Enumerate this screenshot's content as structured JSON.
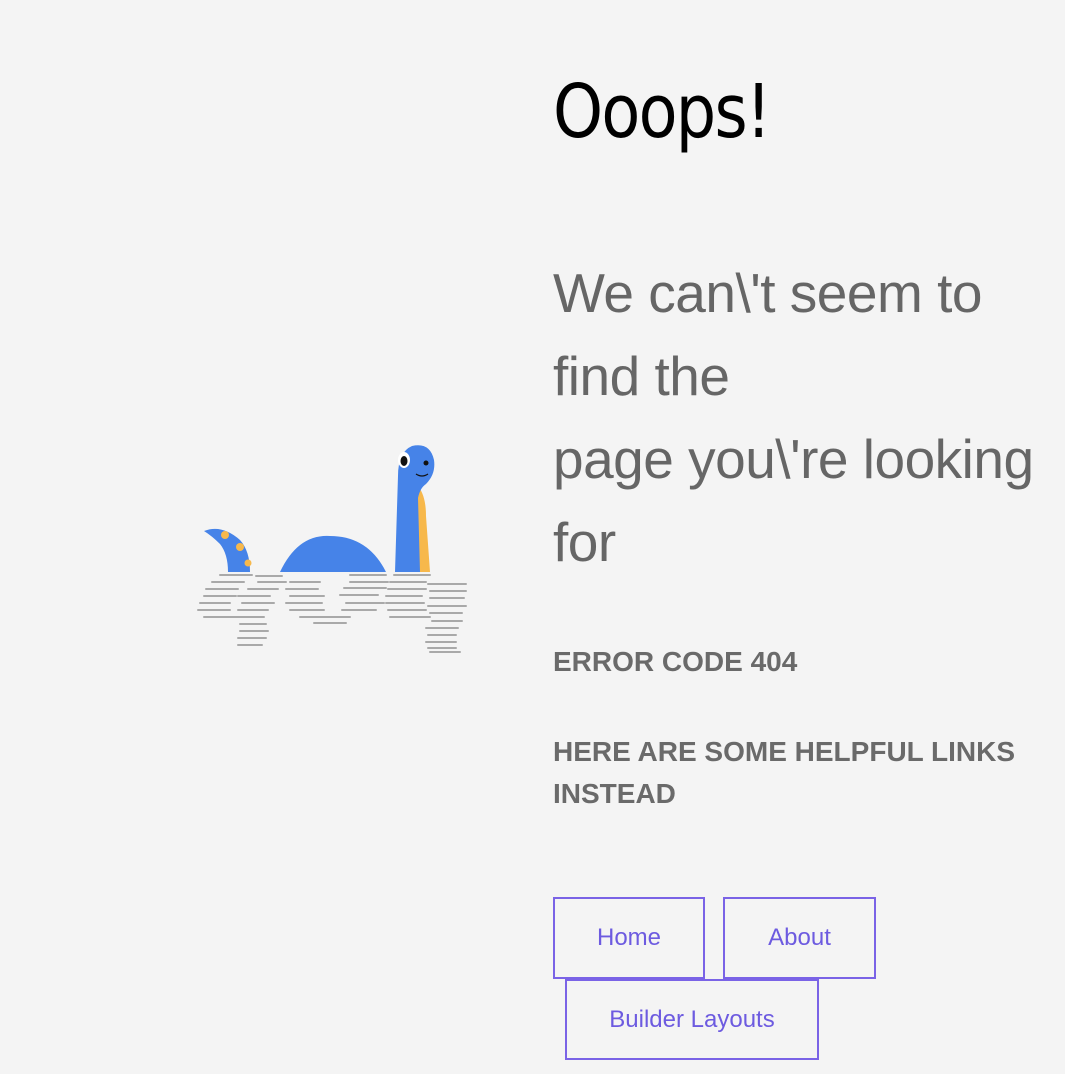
{
  "error_page": {
    "title": "Ooops!",
    "message": "We can\\'t seem to\nfind the\npage you\\'re looking\nfor",
    "error_code": "ERROR CODE 404",
    "helpful_links_heading": "HERE ARE SOME HELPFUL LINKS INSTEAD",
    "links": [
      {
        "label": "Home"
      },
      {
        "label": "About"
      },
      {
        "label": "Builder Layouts"
      }
    ]
  },
  "illustration": {
    "icon": "sea-monster-illustration",
    "colors": {
      "body": "#4683e8",
      "spots": "#f7b84b",
      "ripples": "#a9a9a9"
    }
  },
  "colors": {
    "background": "#f4f4f4",
    "title": "#000000",
    "text": "#666666",
    "link": "#6d5be0"
  }
}
